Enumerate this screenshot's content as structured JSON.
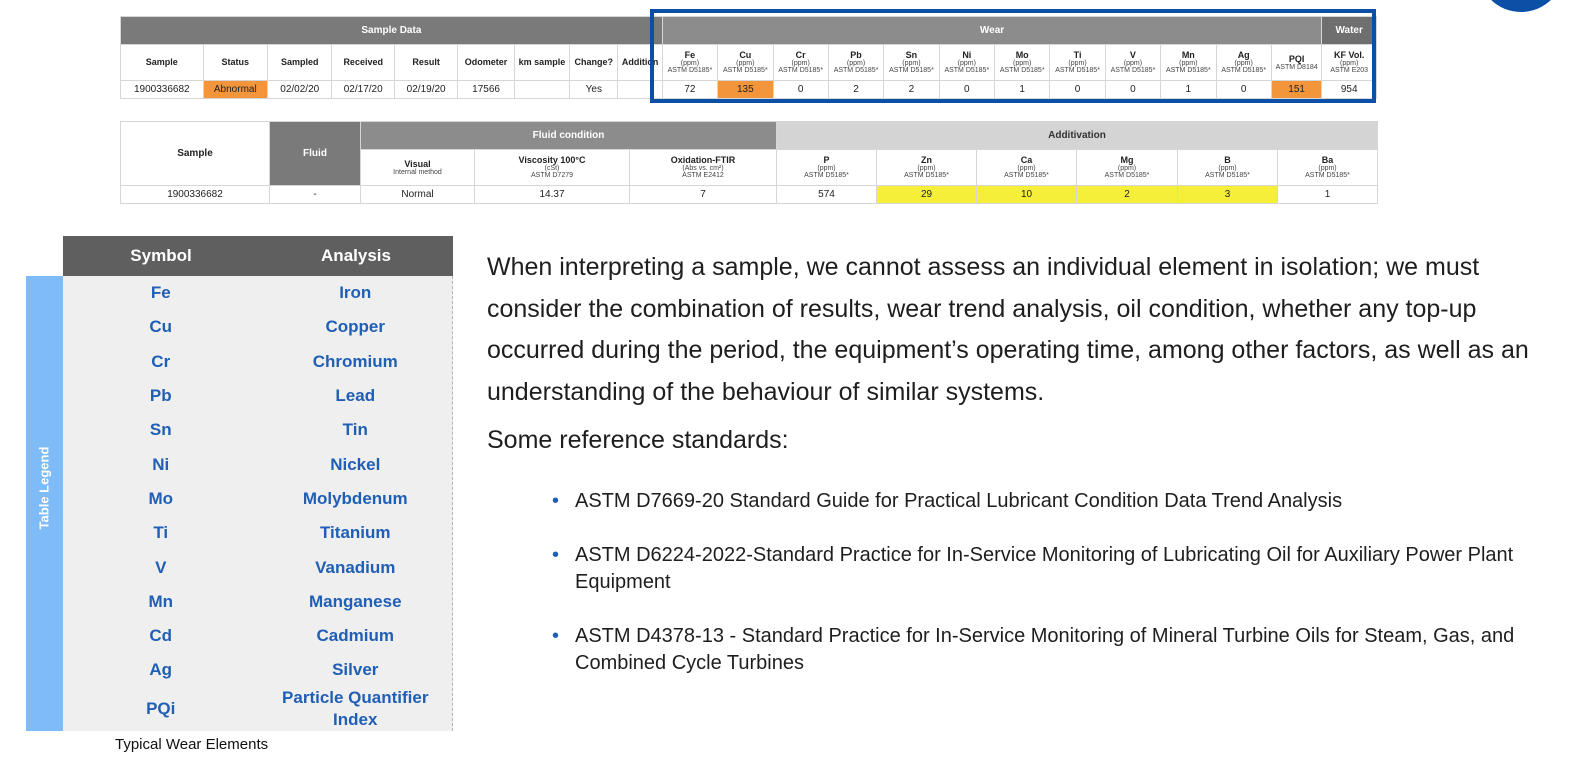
{
  "table1": {
    "group_headers": {
      "sample_data": "Sample Data",
      "wear": "Wear",
      "water": "Water"
    },
    "columns": [
      {
        "label": "Sample",
        "unit": "",
        "method": ""
      },
      {
        "label": "Status",
        "unit": "",
        "method": ""
      },
      {
        "label": "Sampled",
        "unit": "",
        "method": ""
      },
      {
        "label": "Received",
        "unit": "",
        "method": ""
      },
      {
        "label": "Result",
        "unit": "",
        "method": ""
      },
      {
        "label": "Odometer",
        "unit": "",
        "method": ""
      },
      {
        "label": "km sample",
        "unit": "",
        "method": ""
      },
      {
        "label": "Change?",
        "unit": "",
        "method": ""
      },
      {
        "label": "Addition",
        "unit": "",
        "method": ""
      },
      {
        "label": "Fe",
        "unit": "(ppm)",
        "method": "ASTM D5185*"
      },
      {
        "label": "Cu",
        "unit": "(ppm)",
        "method": "ASTM D5185*"
      },
      {
        "label": "Cr",
        "unit": "(ppm)",
        "method": "ASTM D5185*"
      },
      {
        "label": "Pb",
        "unit": "(ppm)",
        "method": "ASTM D5185*"
      },
      {
        "label": "Sn",
        "unit": "(ppm)",
        "method": "ASTM D5185*"
      },
      {
        "label": "Ni",
        "unit": "(ppm)",
        "method": "ASTM D5185*"
      },
      {
        "label": "Mo",
        "unit": "(ppm)",
        "method": "ASTM D5185*"
      },
      {
        "label": "Ti",
        "unit": "(ppm)",
        "method": "ASTM D5185*"
      },
      {
        "label": "V",
        "unit": "(ppm)",
        "method": "ASTM D5185*"
      },
      {
        "label": "Mn",
        "unit": "(ppm)",
        "method": "ASTM D5185*"
      },
      {
        "label": "Ag",
        "unit": "(ppm)",
        "method": "ASTM D5185*"
      },
      {
        "label": "PQI",
        "unit": "",
        "method": "ASTM D8184"
      },
      {
        "label": "KF Vol.",
        "unit": "(ppm)",
        "method": "ASTM E203"
      }
    ],
    "row": [
      "1900336682",
      "Abnormal",
      "02/02/20",
      "02/17/20",
      "02/19/20",
      "17566",
      "",
      "Yes",
      "",
      "72",
      "135",
      "0",
      "2",
      "2",
      "0",
      "1",
      "0",
      "0",
      "1",
      "0",
      "151",
      "954"
    ]
  },
  "table2": {
    "headers": {
      "sample": "Sample",
      "fluid": "Fluid",
      "fluid_condition": "Fluid condition",
      "additivation": "Additivation"
    },
    "columns": [
      {
        "label": "Visual",
        "unit": "",
        "method": "Internal method"
      },
      {
        "label": "Viscosity 100°C",
        "unit": "(cSt)",
        "method": "ASTM D7279"
      },
      {
        "label": "Oxidation-FTIR",
        "unit": "(Abs vs. cm²)",
        "method": "ASTM E2412"
      },
      {
        "label": "P",
        "unit": "(ppm)",
        "method": "ASTM D5185*"
      },
      {
        "label": "Zn",
        "unit": "(ppm)",
        "method": "ASTM D5185*"
      },
      {
        "label": "Ca",
        "unit": "(ppm)",
        "method": "ASTM D5185*"
      },
      {
        "label": "Mg",
        "unit": "(ppm)",
        "method": "ASTM D5185*"
      },
      {
        "label": "B",
        "unit": "(ppm)",
        "method": "ASTM D5185*"
      },
      {
        "label": "Ba",
        "unit": "(ppm)",
        "method": "ASTM D5185*"
      }
    ],
    "row": [
      "1900336682",
      "-",
      "Normal",
      "14.37",
      "7",
      "574",
      "29",
      "10",
      "2",
      "3",
      "1"
    ]
  },
  "legend": {
    "side_label": "Table Legend",
    "header_symbol": "Symbol",
    "header_analysis": "Analysis",
    "rows": [
      {
        "symbol": "Fe",
        "analysis": "Iron"
      },
      {
        "symbol": "Cu",
        "analysis": "Copper"
      },
      {
        "symbol": "Cr",
        "analysis": "Chromium"
      },
      {
        "symbol": "Pb",
        "analysis": "Lead"
      },
      {
        "symbol": "Sn",
        "analysis": "Tin"
      },
      {
        "symbol": "Ni",
        "analysis": "Nickel"
      },
      {
        "symbol": "Mo",
        "analysis": "Molybdenum"
      },
      {
        "symbol": "Ti",
        "analysis": "Titanium"
      },
      {
        "symbol": "V",
        "analysis": "Vanadium"
      },
      {
        "symbol": "Mn",
        "analysis": "Manganese"
      },
      {
        "symbol": "Cd",
        "analysis": "Cadmium"
      },
      {
        "symbol": "Ag",
        "analysis": "Silver"
      },
      {
        "symbol": "PQi",
        "analysis": "Particle Quantifier Index"
      }
    ],
    "caption": "Typical Wear Elements"
  },
  "text": {
    "paragraph": "When interpreting a sample, we cannot assess an individual element in isolation; we must consider the combination of results, wear trend analysis, oil condition, whether any top-up occurred during the period, the equipment’s operating time, among other factors, as well as an understanding of the behaviour of similar systems.",
    "references_intro": "Some reference standards:",
    "references": [
      "ASTM D7669-20 Standard Guide for Practical Lubricant Condition Data Trend Analysis",
      "ASTM D6224-2022-Standard Practice for In-Service Monitoring of Lubricating Oil for Auxiliary Power Plant Equipment",
      "ASTM D4378-13 - Standard Practice for In-Service Monitoring of Mineral Turbine Oils for Steam, Gas, and Combined Cycle Turbines"
    ]
  },
  "colors": {
    "accent_blue": "#0b4fa6",
    "legend_side": "#7fbcf7",
    "highlight_orange": "#f3953b",
    "highlight_yellow": "#f5ef3a"
  }
}
